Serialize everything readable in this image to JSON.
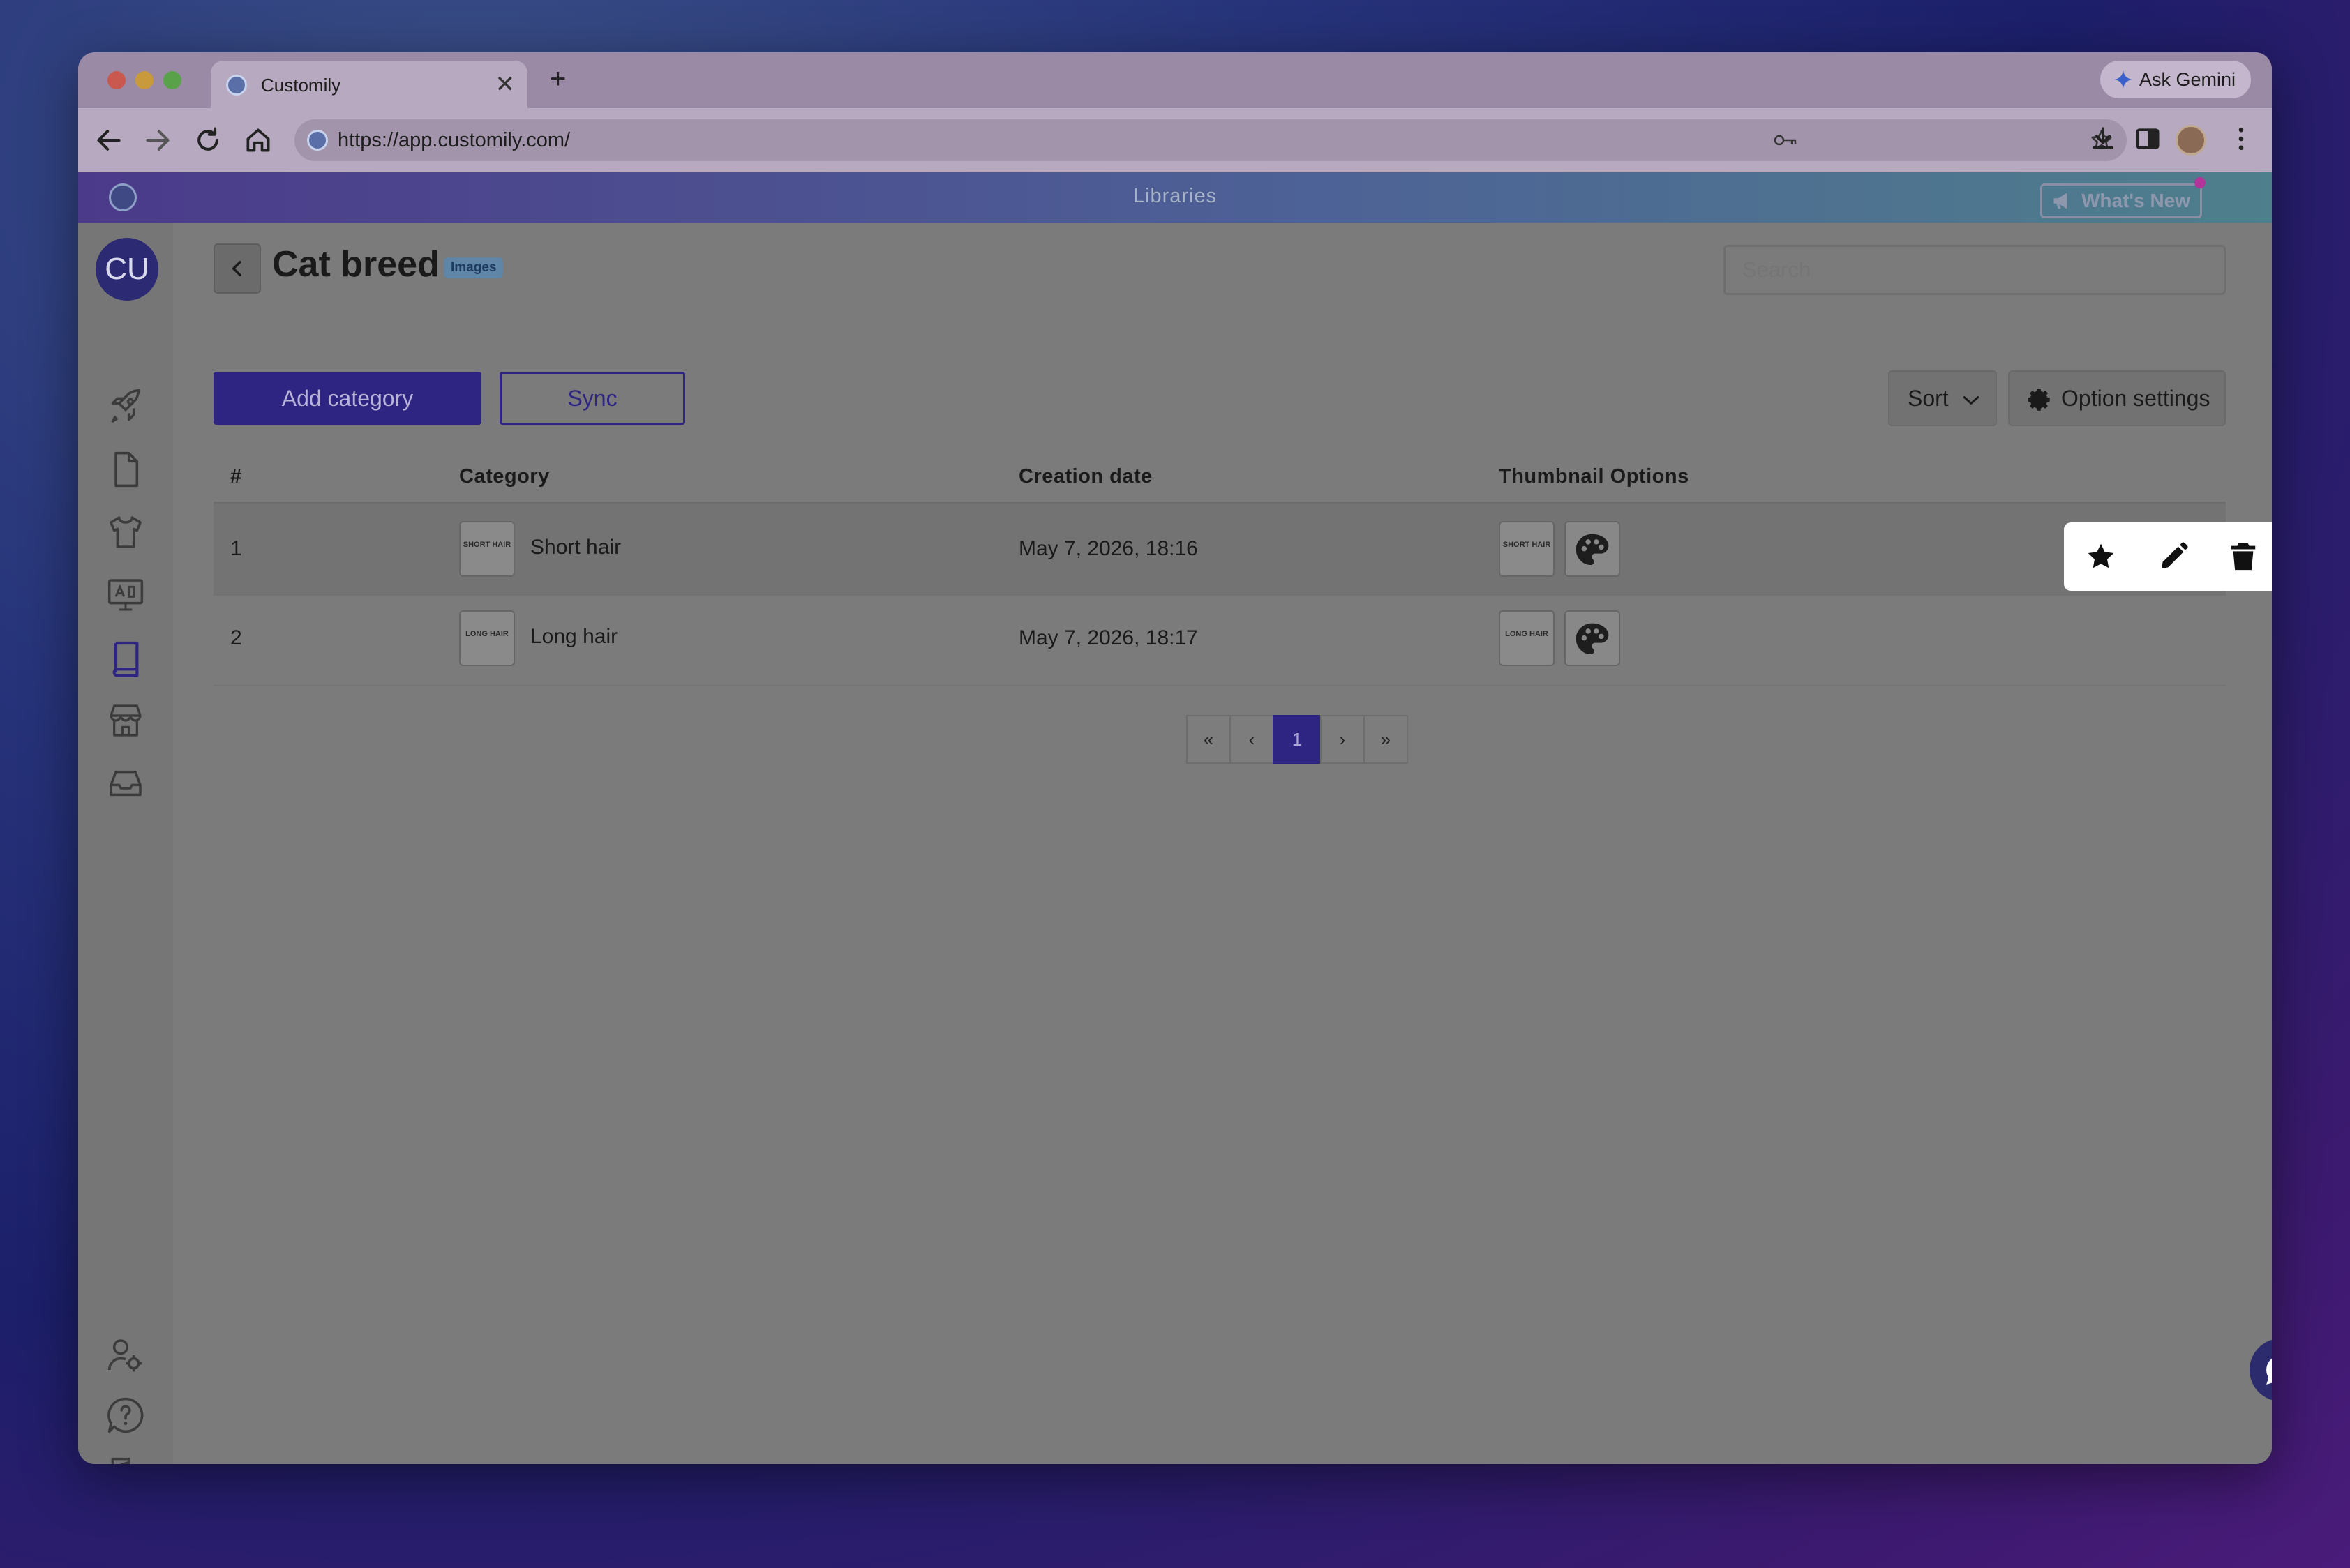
{
  "browser": {
    "tab_title": "Customily",
    "tab_close": "✕",
    "new_tab": "+",
    "gemini_label": "Ask Gemini",
    "url": "https://app.customily.com/"
  },
  "appbar": {
    "section_title": "Libraries",
    "whats_new": "What's New"
  },
  "sidebar": {
    "avatar_initials": "CU",
    "items": [
      "rocket-icon",
      "file-icon",
      "tshirt-icon",
      "monitor-icon",
      "book-icon",
      "store-icon",
      "inbox-icon"
    ],
    "bottom_items": [
      "user-settings-icon",
      "help-icon",
      "logout-icon"
    ]
  },
  "page": {
    "title": "Cat breed",
    "type_badge": "Images",
    "search_placeholder": "Search",
    "add_category": "Add category",
    "sync": "Sync",
    "sort": "Sort",
    "option_settings": "Option settings"
  },
  "table": {
    "headers": [
      "#",
      "Category",
      "Creation date",
      "Thumbnail Options"
    ],
    "rows": [
      {
        "index": "1",
        "thumb_text": "SHORT HAIR",
        "name": "Short hair",
        "date": "May 7, 2026, 18:16"
      },
      {
        "index": "2",
        "thumb_text": "LONG HAIR",
        "name": "Long hair",
        "date": "May 7, 2026, 18:17"
      }
    ]
  },
  "pagination": {
    "first": "«",
    "prev": "‹",
    "current": "1",
    "next": "›",
    "last": "»"
  },
  "colors": {
    "accent": "#2e2582",
    "overlay_gray": "#7b7b7b"
  }
}
